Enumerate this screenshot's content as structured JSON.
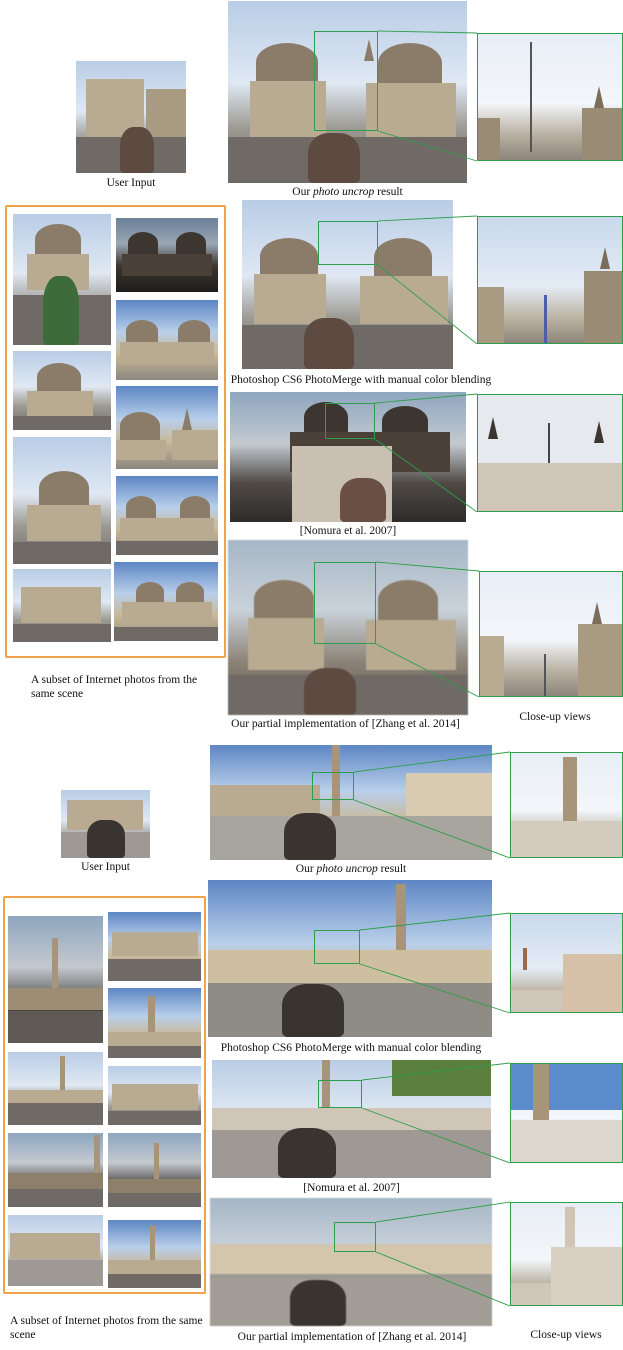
{
  "figure": {
    "top": {
      "user_input_caption": "User Input",
      "uncrop_caption_prefix": "Our ",
      "uncrop_caption_emph": "photo uncrop",
      "uncrop_caption_suffix": " result",
      "photoshop_caption": "Photoshop CS6 PhotoMerge with manual color blending",
      "nomura_caption": "[Nomura et al. 2007]",
      "zhang_caption": "Our partial implementation of [Zhang et al. 2014]",
      "closeup_caption": "Close-up views",
      "subset_caption": "A subset of Internet photos from the same scene"
    },
    "bottom": {
      "user_input_caption": "User Input",
      "uncrop_caption_prefix": "Our ",
      "uncrop_caption_emph": "photo uncrop",
      "uncrop_caption_suffix": " result",
      "photoshop_caption": "Photoshop CS6 PhotoMerge with manual color blending",
      "nomura_caption": "[Nomura et al. 2007]",
      "zhang_caption": "Our partial implementation of [Zhang et al. 2014]",
      "closeup_caption": "Close-up views",
      "subset_caption": "A subset of Internet photos from the same scene"
    }
  },
  "colors": {
    "highlight_frame": "#f0a24a",
    "zoom_box": "#2e9e4a"
  }
}
